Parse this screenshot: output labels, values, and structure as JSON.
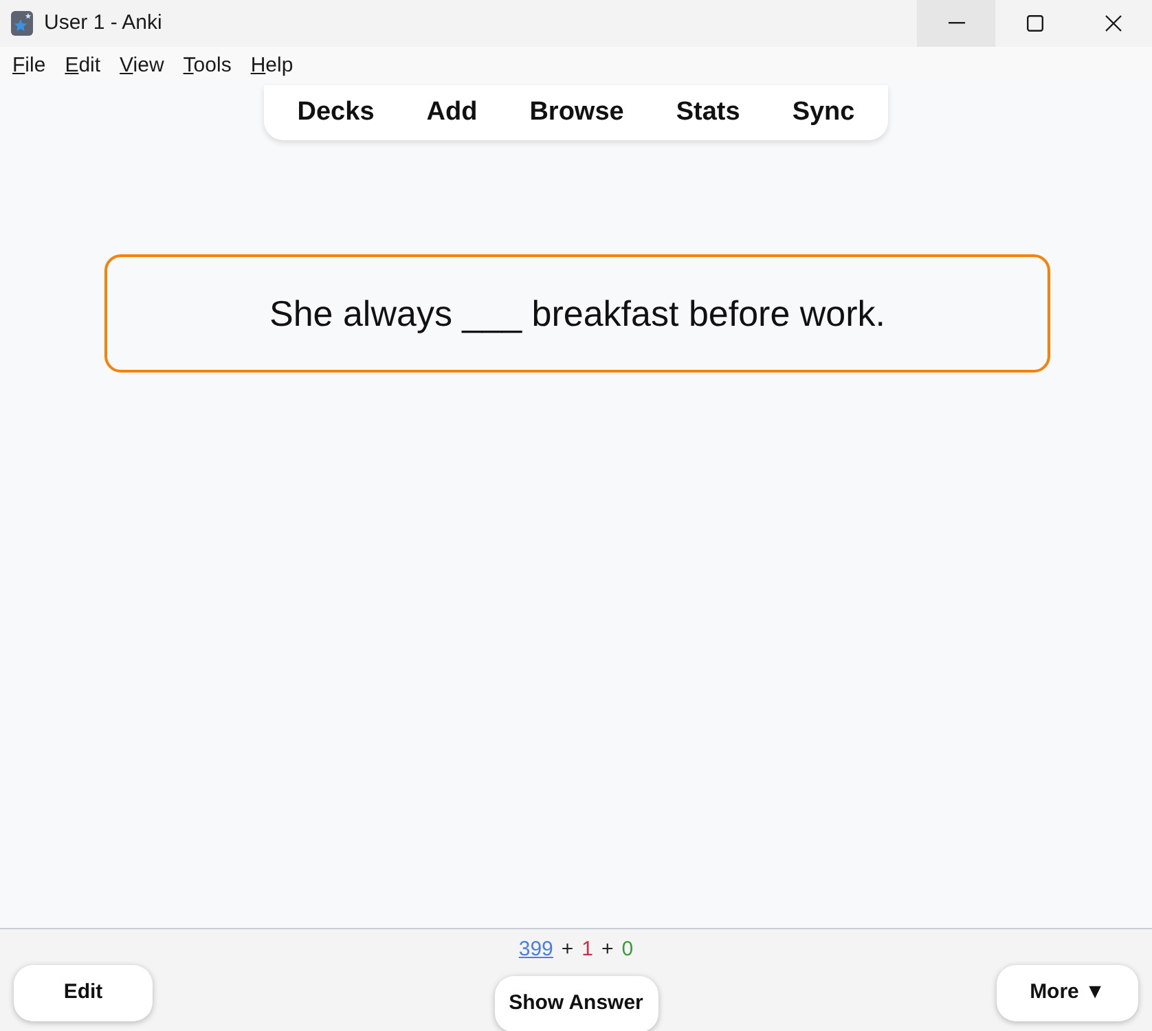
{
  "window": {
    "title": "User 1 - Anki",
    "controls": [
      {
        "kind": "minimize",
        "hovered": true
      },
      {
        "kind": "maximize",
        "hovered": false
      },
      {
        "kind": "close",
        "hovered": false
      }
    ]
  },
  "menu": [
    "File",
    "Edit",
    "View",
    "Tools",
    "Help"
  ],
  "toolbar": [
    "Decks",
    "Add",
    "Browse",
    "Stats",
    "Sync"
  ],
  "card": {
    "question": "She always ___ breakfast before work."
  },
  "bottom_bar": {
    "counts": [
      {
        "kind": "link",
        "text": "399",
        "color": "#4a7fe0"
      },
      {
        "kind": "separator",
        "text": "+"
      },
      {
        "kind": "count",
        "text": "1",
        "color": "#c8304a"
      },
      {
        "kind": "separator",
        "text": "+"
      },
      {
        "kind": "count",
        "text": "0",
        "color": "#3a9a3e"
      }
    ],
    "edit_button": "Edit",
    "answer_button": "Show Answer",
    "more_button": "More ▼"
  }
}
